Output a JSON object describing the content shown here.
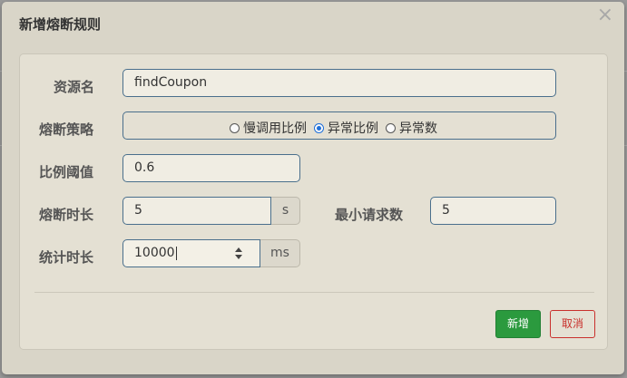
{
  "dialog": {
    "title": "新增熔断规则",
    "close_symbol": "×"
  },
  "form": {
    "resource": {
      "label": "资源名",
      "value": "findCoupon"
    },
    "strategy": {
      "label": "熔断策略",
      "options": [
        "慢调用比例",
        "异常比例",
        "异常数"
      ],
      "selected": "异常比例"
    },
    "ratio_threshold": {
      "label": "比例阈值",
      "value": "0.6"
    },
    "break_duration": {
      "label": "熔断时长",
      "value": "5",
      "unit": "s"
    },
    "min_requests": {
      "label": "最小请求数",
      "value": "5"
    },
    "stat_duration": {
      "label": "统计时长",
      "value": "10000",
      "unit": "ms"
    }
  },
  "footer": {
    "submit_label": "新增",
    "cancel_label": "取消"
  },
  "colors": {
    "primary": "#2b9a3e",
    "danger": "#c9302c",
    "input_border": "#4a6f8c",
    "radio_checked": "#1e6fd9"
  }
}
